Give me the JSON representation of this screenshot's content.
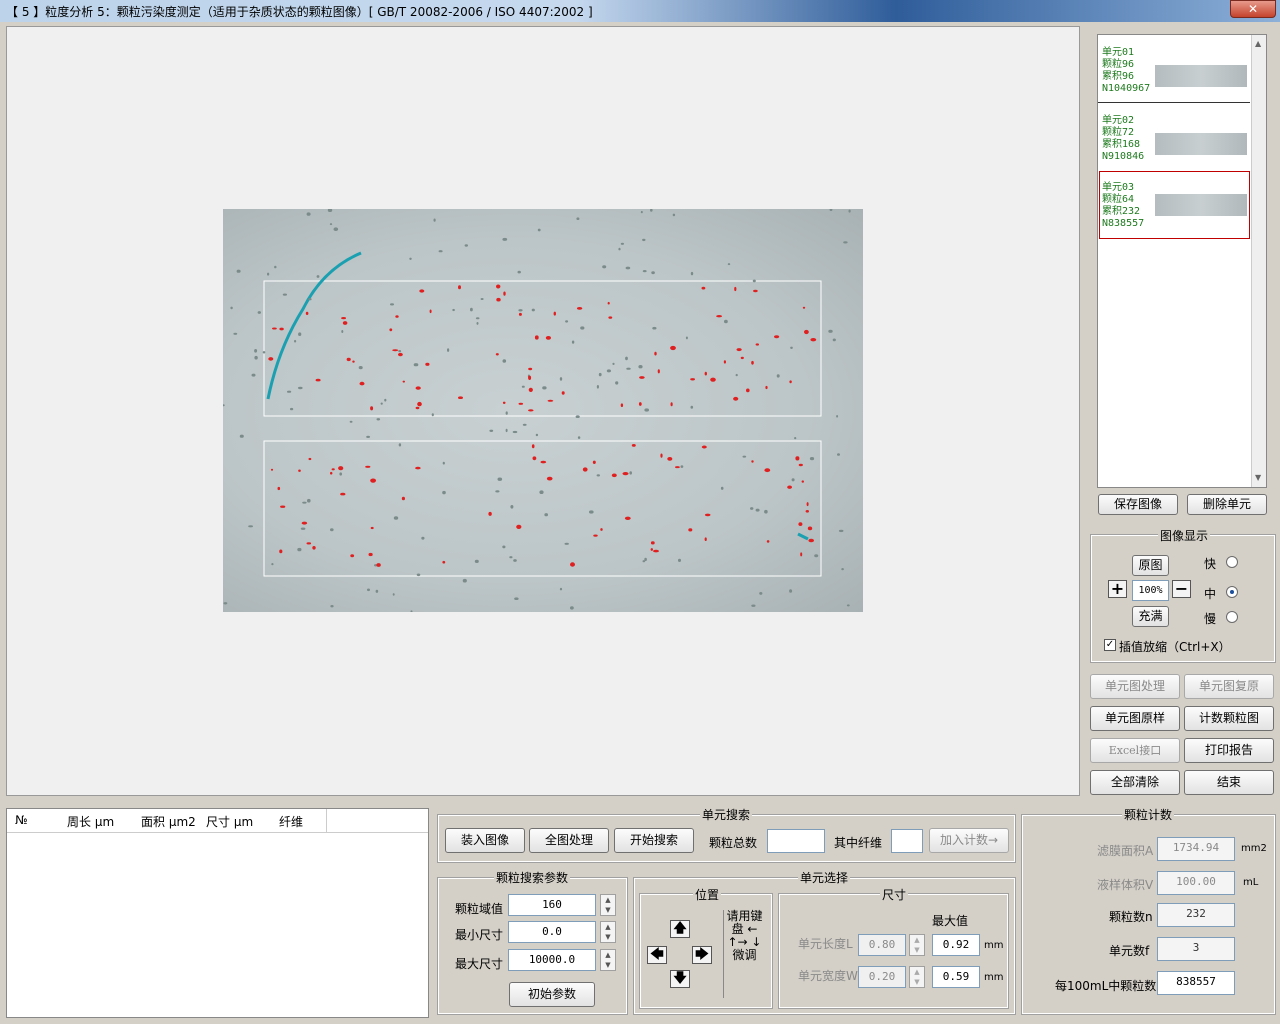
{
  "window": {
    "title": "【 5 】粒度分析 5：颗粒污染度测定（适用于杂质状态的颗粒图像）[   GB/T 20082-2006 / ISO 4407:2002  ]",
    "close": "✕"
  },
  "colors": {
    "accent_selected": "#c00000",
    "thumb_text": "#1d7a1d",
    "particle": "#e02020",
    "fiber": "#1aa0b0"
  },
  "thumbnails": [
    {
      "lines": [
        "单元01",
        "颗粒96",
        "累积96",
        "N1040967"
      ]
    },
    {
      "lines": [
        "单元02",
        "颗粒72",
        "累积168",
        "N910846"
      ]
    },
    {
      "lines": [
        "单元03",
        "颗粒64",
        "累积232",
        "N838557"
      ]
    }
  ],
  "thumb_buttons": {
    "save": "保存图像",
    "delete": "删除单元"
  },
  "image_display": {
    "title": "图像显示",
    "original": "原图",
    "zoom": "100%",
    "fill": "充满",
    "plus": "+",
    "minus": "−",
    "speed_fast": "快",
    "speed_mid": "中",
    "speed_slow": "慢",
    "interp": "插值放缩（Ctrl+X）",
    "check": "✓"
  },
  "right_buttons": {
    "unit_process": "单元图处理",
    "unit_restore": "单元图复原",
    "unit_original": "单元图原样",
    "count_particles": "计数颗粒图",
    "excel": "Excel接口",
    "print": "打印报告",
    "clear_all": "全部清除",
    "end": "结束"
  },
  "table": {
    "headers": [
      "№",
      "周长 μm",
      "面积 μm2",
      "尺寸 μm",
      "纤维"
    ]
  },
  "unit_search": {
    "title": "单元搜索",
    "load": "装入图像",
    "full_process": "全图处理",
    "start_search": "开始搜索",
    "total_label": "颗粒总数",
    "fiber_label": "其中纤维",
    "add_count": "加入计数→"
  },
  "params": {
    "title": "颗粒搜索参数",
    "threshold_label": "颗粒域值",
    "threshold": "160",
    "min_label": "最小尺寸",
    "min": "0.0",
    "max_label": "最大尺寸",
    "max": "10000.0",
    "init": "初始参数"
  },
  "unit_select": {
    "title": "单元选择",
    "position": "位置",
    "keyboard_hint_1": "请用键",
    "keyboard_hint_2": "盘 ←",
    "keyboard_hint_3": "↑→ ↓",
    "keyboard_hint_4": "微调",
    "size": "尺寸",
    "max_value": "最大值",
    "len_label": "单元长度L",
    "len": "0.80",
    "len_max": "0.92",
    "wid_label": "单元宽度W",
    "wid": "0.20",
    "wid_max": "0.59",
    "unit_mm": "mm",
    "up": "🡅",
    "down": "🡇",
    "left": "🡄",
    "right": "🡆"
  },
  "particle_count": {
    "title": "颗粒计数",
    "area_label": "滤膜面积A",
    "area": "1734.94",
    "area_unit": "mm2",
    "volume_label": "液样体积V",
    "volume": "100.00",
    "volume_unit": "mL",
    "count_label": "颗粒数n",
    "count": "232",
    "units_label": "单元数f",
    "units": "3",
    "per100_label": "每100mL中颗粒数N",
    "per100": "838557"
  }
}
